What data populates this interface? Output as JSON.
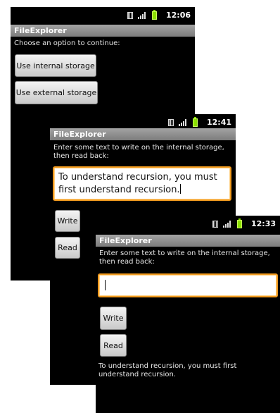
{
  "screens": [
    {
      "clock": "12:06",
      "app_title": "FileExplorer",
      "prompt": "Choose an option to continue:",
      "buttons": [
        "Use internal storage",
        "Use external storage"
      ]
    },
    {
      "clock": "12:41",
      "app_title": "FileExplorer",
      "prompt_line1": "Enter some text to write on the internal storage,",
      "prompt_line2": "then read back:",
      "input_value": "To understand recursion, you must first understand recursion.",
      "write_label": "Write",
      "read_label": "Read"
    },
    {
      "clock": "12:33",
      "app_title": "FileExplorer",
      "prompt_line1": "Enter some text to write on the internal storage,",
      "prompt_line2": "then read back:",
      "input_value": "",
      "write_label": "Write",
      "read_label": "Read",
      "output_text": "To understand recursion, you must first understand recursion."
    }
  ],
  "icons": {
    "sim": "sim-card-icon",
    "signal": "signal-strength-icon",
    "battery": "battery-icon"
  },
  "colors": {
    "background": "#000000",
    "titlebar": "#8c8c8c",
    "input_focus": "#f29b1f",
    "battery": "#8be000"
  }
}
